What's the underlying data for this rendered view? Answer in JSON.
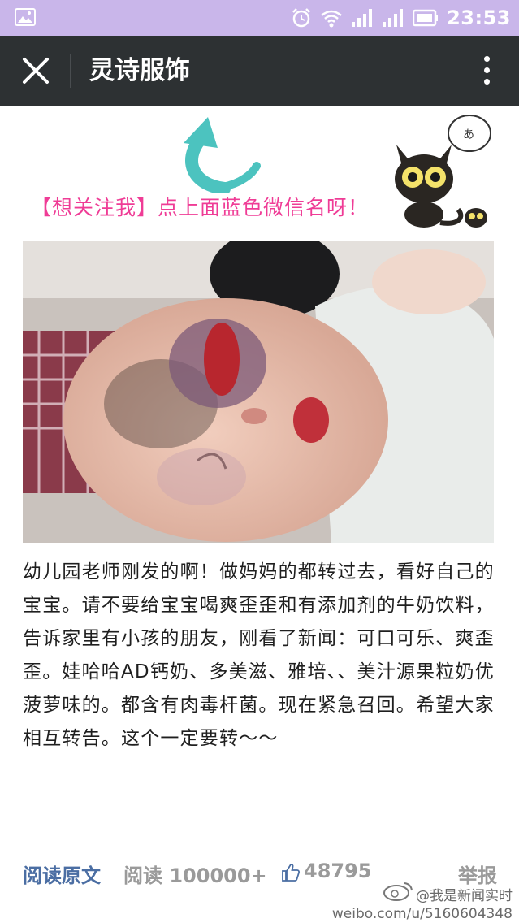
{
  "status_bar": {
    "time": "23:53",
    "icons": [
      "gallery-icon",
      "alarm-icon",
      "wifi-icon",
      "signal-icon",
      "signal-icon",
      "battery-icon"
    ]
  },
  "header": {
    "title": "灵诗服饰",
    "close_icon": "close-icon",
    "menu_icon": "more-vertical-icon"
  },
  "banner": {
    "text": "【想关注我】点上面蓝色微信名呀！",
    "arrow_color": "#4cc3bf",
    "text_color": "#ef3c96"
  },
  "article": {
    "body": "幼儿园老师刚发的啊！做妈妈的都转过去，看好自己的宝宝。请不要给宝宝喝爽歪歪和有添加剂的牛奶饮料，告诉家里有小孩的朋友，刚看了新闻：可口可乐、爽歪歪。娃哈哈AD钙奶、多美滋、雅培、、美汁源果粒奶优菠萝味的。都含有肉毒杆菌。现在紧急召回。希望大家相互转告。这个一定要转～～"
  },
  "footer": {
    "read_original": "阅读原文",
    "read_count": "阅读 100000+",
    "like_count": "48795",
    "report": "举报"
  },
  "watermark": {
    "line1": "@我是新闻实时",
    "line2": "weibo.com/u/5160604348"
  },
  "colors": {
    "status_bar_bg": "#c9b6ea",
    "header_bg": "#2d3133",
    "link_blue": "#4b6ea3",
    "meta_gray": "#9a9a9a"
  }
}
